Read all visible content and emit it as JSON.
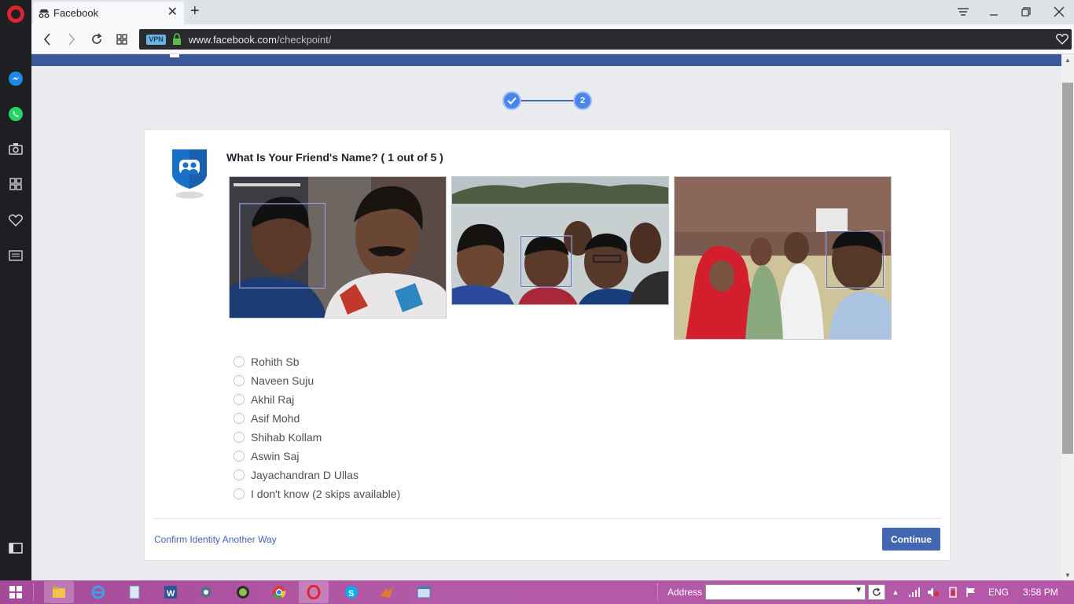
{
  "browser": {
    "tab_title": "Facebook",
    "url_domain": "www.facebook.com",
    "url_path": "/checkpoint/",
    "vpn_label": "VPN"
  },
  "stepper": {
    "step2_label": "2"
  },
  "checkpoint": {
    "question": "What Is Your Friend's Name? ( 1 out of 5 )",
    "options": [
      "Rohith Sb",
      "Naveen Suju",
      "Akhil Raj",
      "Asif Mohd",
      "Shihab Kollam",
      "Aswin Saj",
      "Jayachandran D Ullas",
      "I don't know (2 skips available)"
    ],
    "alt_link": "Confirm Identity Another Way",
    "continue_label": "Continue"
  },
  "taskbar": {
    "address_label": "Address",
    "language": "ENG",
    "time": "3:58 PM"
  },
  "colors": {
    "facebook_blue": "#3b5998",
    "button_blue": "#4267b2",
    "step_blue": "#4a86e8",
    "opera_red": "#e0242f"
  }
}
